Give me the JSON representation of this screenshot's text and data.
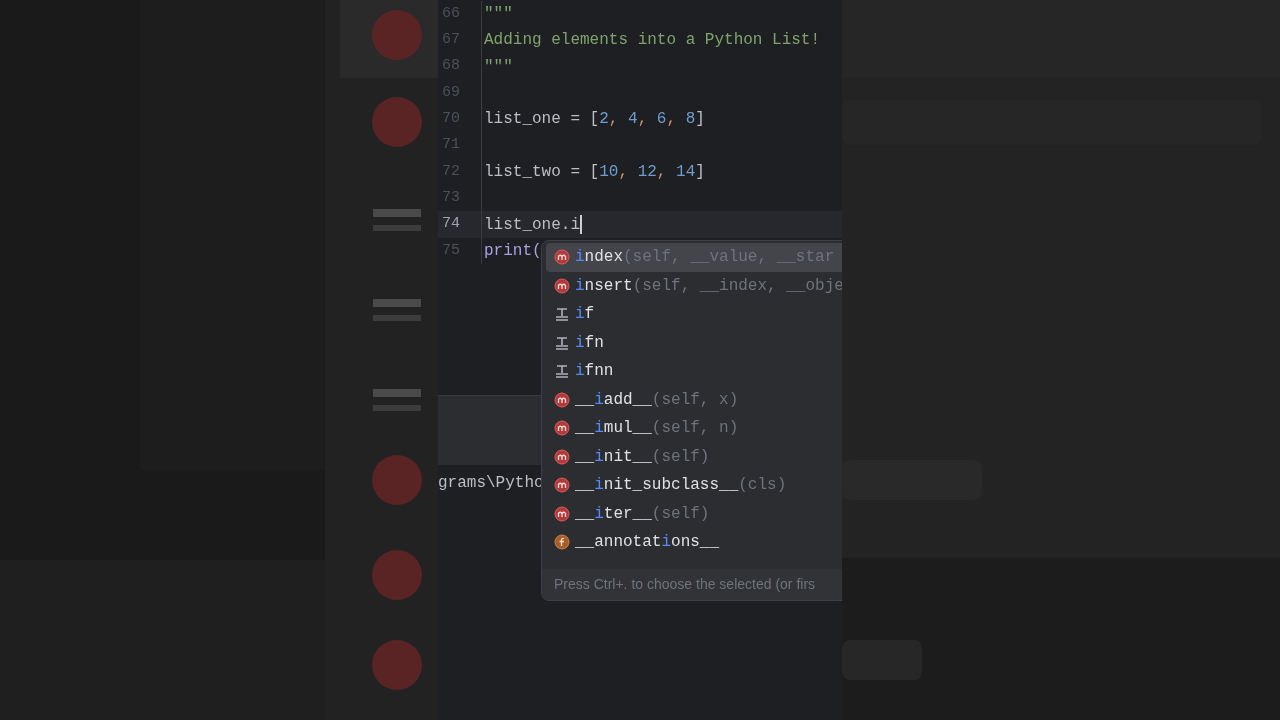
{
  "editor": {
    "lines": [
      {
        "number": "66",
        "current": false,
        "tokens": [
          {
            "text": "\"\"\"",
            "kind": "doc"
          }
        ]
      },
      {
        "number": "67",
        "current": false,
        "tokens": [
          {
            "text": "Adding elements into a Python List!",
            "kind": "doc"
          }
        ]
      },
      {
        "number": "68",
        "current": false,
        "tokens": [
          {
            "text": "\"\"\"",
            "kind": "doc"
          }
        ]
      },
      {
        "number": "69",
        "current": false
      },
      {
        "number": "70",
        "current": false,
        "tokens": [
          {
            "text": "list_one = [",
            "kind": "ident"
          },
          {
            "text": "2",
            "kind": "number"
          },
          {
            "text": ", ",
            "kind": "comma"
          },
          {
            "text": "4",
            "kind": "number"
          },
          {
            "text": ", ",
            "kind": "comma"
          },
          {
            "text": "6",
            "kind": "number"
          },
          {
            "text": ", ",
            "kind": "comma"
          },
          {
            "text": "8",
            "kind": "number"
          },
          {
            "text": "]",
            "kind": "ident"
          }
        ]
      },
      {
        "number": "71",
        "current": false
      },
      {
        "number": "72",
        "current": false,
        "tokens": [
          {
            "text": "list_two = [",
            "kind": "ident"
          },
          {
            "text": "10",
            "kind": "number"
          },
          {
            "text": ", ",
            "kind": "comma"
          },
          {
            "text": "12",
            "kind": "number"
          },
          {
            "text": ", ",
            "kind": "comma"
          },
          {
            "text": "14",
            "kind": "number"
          },
          {
            "text": "]",
            "kind": "ident"
          }
        ]
      },
      {
        "number": "73",
        "current": false
      },
      {
        "number": "74",
        "current": true,
        "caret": true,
        "tokens": [
          {
            "text": "list_one.i",
            "kind": "ident"
          }
        ]
      },
      {
        "number": "75",
        "current": false,
        "tokens": [
          {
            "text": "print(",
            "kind": "builtin"
          }
        ]
      }
    ]
  },
  "console": {
    "text": "grams\\Pytho"
  },
  "completion": {
    "items": [
      {
        "kind": "method",
        "selected": true,
        "match": "i",
        "after": "ndex",
        "params": "(self, __value, __star"
      },
      {
        "kind": "method",
        "selected": false,
        "match": "i",
        "after": "nsert",
        "params": "(self, __index, __obje"
      },
      {
        "kind": "template",
        "selected": false,
        "match": "i",
        "after": "f"
      },
      {
        "kind": "template",
        "selected": false,
        "match": "i",
        "after": "fn"
      },
      {
        "kind": "template",
        "selected": false,
        "match": "i",
        "after": "fnn"
      },
      {
        "kind": "method",
        "selected": false,
        "before": "__",
        "match": "i",
        "after": "add__",
        "params": "(self, x)"
      },
      {
        "kind": "method",
        "selected": false,
        "before": "__",
        "match": "i",
        "after": "mul__",
        "params": "(self, n)"
      },
      {
        "kind": "method",
        "selected": false,
        "before": "__",
        "match": "i",
        "after": "nit__",
        "params": "(self)"
      },
      {
        "kind": "method",
        "selected": false,
        "before": "__",
        "match": "i",
        "after": "nit_subclass__",
        "params": "(cls)"
      },
      {
        "kind": "method",
        "selected": false,
        "before": "__",
        "match": "i",
        "after": "ter__",
        "params": "(self)"
      },
      {
        "kind": "field",
        "selected": false,
        "before": "__annotat",
        "match": "i",
        "after": "ons__"
      }
    ],
    "hint": "Press Ctrl+. to choose the selected (or firs"
  }
}
